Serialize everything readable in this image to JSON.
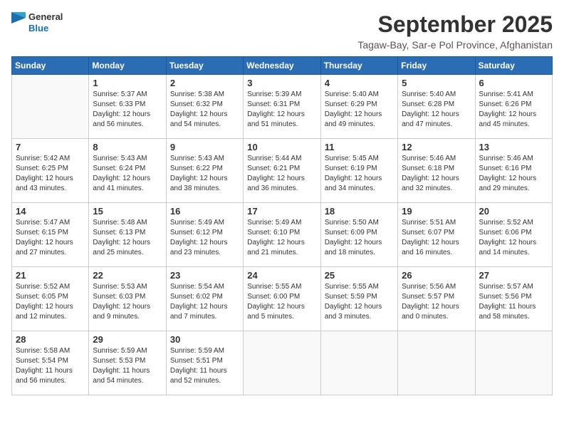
{
  "logo": {
    "line1": "General",
    "line2": "Blue"
  },
  "title": "September 2025",
  "location": "Tagaw-Bay, Sar-e Pol Province, Afghanistan",
  "weekdays": [
    "Sunday",
    "Monday",
    "Tuesday",
    "Wednesday",
    "Thursday",
    "Friday",
    "Saturday"
  ],
  "weeks": [
    [
      {
        "day": "",
        "info": ""
      },
      {
        "day": "1",
        "info": "Sunrise: 5:37 AM\nSunset: 6:33 PM\nDaylight: 12 hours\nand 56 minutes."
      },
      {
        "day": "2",
        "info": "Sunrise: 5:38 AM\nSunset: 6:32 PM\nDaylight: 12 hours\nand 54 minutes."
      },
      {
        "day": "3",
        "info": "Sunrise: 5:39 AM\nSunset: 6:31 PM\nDaylight: 12 hours\nand 51 minutes."
      },
      {
        "day": "4",
        "info": "Sunrise: 5:40 AM\nSunset: 6:29 PM\nDaylight: 12 hours\nand 49 minutes."
      },
      {
        "day": "5",
        "info": "Sunrise: 5:40 AM\nSunset: 6:28 PM\nDaylight: 12 hours\nand 47 minutes."
      },
      {
        "day": "6",
        "info": "Sunrise: 5:41 AM\nSunset: 6:26 PM\nDaylight: 12 hours\nand 45 minutes."
      }
    ],
    [
      {
        "day": "7",
        "info": "Sunrise: 5:42 AM\nSunset: 6:25 PM\nDaylight: 12 hours\nand 43 minutes."
      },
      {
        "day": "8",
        "info": "Sunrise: 5:43 AM\nSunset: 6:24 PM\nDaylight: 12 hours\nand 41 minutes."
      },
      {
        "day": "9",
        "info": "Sunrise: 5:43 AM\nSunset: 6:22 PM\nDaylight: 12 hours\nand 38 minutes."
      },
      {
        "day": "10",
        "info": "Sunrise: 5:44 AM\nSunset: 6:21 PM\nDaylight: 12 hours\nand 36 minutes."
      },
      {
        "day": "11",
        "info": "Sunrise: 5:45 AM\nSunset: 6:19 PM\nDaylight: 12 hours\nand 34 minutes."
      },
      {
        "day": "12",
        "info": "Sunrise: 5:46 AM\nSunset: 6:18 PM\nDaylight: 12 hours\nand 32 minutes."
      },
      {
        "day": "13",
        "info": "Sunrise: 5:46 AM\nSunset: 6:16 PM\nDaylight: 12 hours\nand 29 minutes."
      }
    ],
    [
      {
        "day": "14",
        "info": "Sunrise: 5:47 AM\nSunset: 6:15 PM\nDaylight: 12 hours\nand 27 minutes."
      },
      {
        "day": "15",
        "info": "Sunrise: 5:48 AM\nSunset: 6:13 PM\nDaylight: 12 hours\nand 25 minutes."
      },
      {
        "day": "16",
        "info": "Sunrise: 5:49 AM\nSunset: 6:12 PM\nDaylight: 12 hours\nand 23 minutes."
      },
      {
        "day": "17",
        "info": "Sunrise: 5:49 AM\nSunset: 6:10 PM\nDaylight: 12 hours\nand 21 minutes."
      },
      {
        "day": "18",
        "info": "Sunrise: 5:50 AM\nSunset: 6:09 PM\nDaylight: 12 hours\nand 18 minutes."
      },
      {
        "day": "19",
        "info": "Sunrise: 5:51 AM\nSunset: 6:07 PM\nDaylight: 12 hours\nand 16 minutes."
      },
      {
        "day": "20",
        "info": "Sunrise: 5:52 AM\nSunset: 6:06 PM\nDaylight: 12 hours\nand 14 minutes."
      }
    ],
    [
      {
        "day": "21",
        "info": "Sunrise: 5:52 AM\nSunset: 6:05 PM\nDaylight: 12 hours\nand 12 minutes."
      },
      {
        "day": "22",
        "info": "Sunrise: 5:53 AM\nSunset: 6:03 PM\nDaylight: 12 hours\nand 9 minutes."
      },
      {
        "day": "23",
        "info": "Sunrise: 5:54 AM\nSunset: 6:02 PM\nDaylight: 12 hours\nand 7 minutes."
      },
      {
        "day": "24",
        "info": "Sunrise: 5:55 AM\nSunset: 6:00 PM\nDaylight: 12 hours\nand 5 minutes."
      },
      {
        "day": "25",
        "info": "Sunrise: 5:55 AM\nSunset: 5:59 PM\nDaylight: 12 hours\nand 3 minutes."
      },
      {
        "day": "26",
        "info": "Sunrise: 5:56 AM\nSunset: 5:57 PM\nDaylight: 12 hours\nand 0 minutes."
      },
      {
        "day": "27",
        "info": "Sunrise: 5:57 AM\nSunset: 5:56 PM\nDaylight: 11 hours\nand 58 minutes."
      }
    ],
    [
      {
        "day": "28",
        "info": "Sunrise: 5:58 AM\nSunset: 5:54 PM\nDaylight: 11 hours\nand 56 minutes."
      },
      {
        "day": "29",
        "info": "Sunrise: 5:59 AM\nSunset: 5:53 PM\nDaylight: 11 hours\nand 54 minutes."
      },
      {
        "day": "30",
        "info": "Sunrise: 5:59 AM\nSunset: 5:51 PM\nDaylight: 11 hours\nand 52 minutes."
      },
      {
        "day": "",
        "info": ""
      },
      {
        "day": "",
        "info": ""
      },
      {
        "day": "",
        "info": ""
      },
      {
        "day": "",
        "info": ""
      }
    ]
  ]
}
